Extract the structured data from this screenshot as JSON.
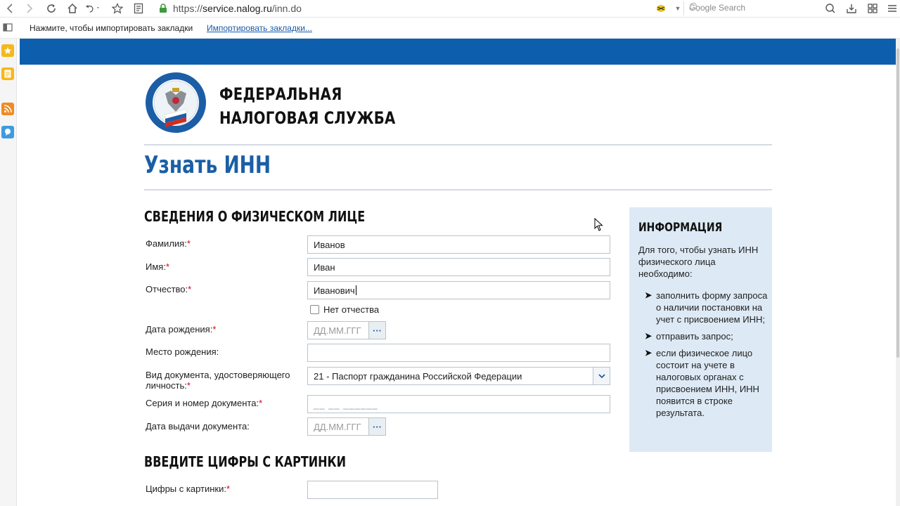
{
  "browser": {
    "url_scheme": "https://",
    "url_host": "service.nalog.ru",
    "url_path": "/inn.do",
    "search_placeholder": "Google Search",
    "bookmarks_prompt": "Нажмите, чтобы импортировать закладки",
    "bookmarks_link": "Импортировать закладки...",
    "icons": [
      "back-icon",
      "forward-icon",
      "reload-icon",
      "home-icon",
      "undo-icon",
      "star-icon",
      "reader-icon",
      "lock-icon",
      "extension-icon",
      "search-icon",
      "account-icon",
      "download-icon",
      "grid-icon",
      "menu-icon"
    ]
  },
  "header": {
    "org_line1": "ФЕДЕРАЛЬНАЯ",
    "org_line2": "НАЛОГОВАЯ СЛУЖБА",
    "page_title": "Узнать ИНН"
  },
  "form": {
    "section_title": "СВЕДЕНИЯ О ФИЗИЧЕСКОМ ЛИЦЕ",
    "required_mark": "*",
    "surname": {
      "label": "Фамилия:",
      "value": "Иванов"
    },
    "name": {
      "label": "Имя:",
      "value": "Иван"
    },
    "patronymic": {
      "label": "Отчество:",
      "value": "Иванович"
    },
    "no_patronymic_label": "Нет отчества",
    "birth_date": {
      "label": "Дата рождения:",
      "placeholder": "ДД.ММ.ГГГ",
      "button": "···"
    },
    "birth_place": {
      "label": "Место рождения:",
      "value": ""
    },
    "doc_type": {
      "label_line1": "Вид документа, удостоверяющего",
      "label_line2": "личность:",
      "value": "21 - Паспорт гражданина Российской Федерации"
    },
    "doc_number": {
      "label": "Серия и номер документа:",
      "mask": "__ __ ______"
    },
    "issue_date": {
      "label": "Дата выдачи документа:",
      "placeholder": "ДД.ММ.ГГГ",
      "button": "···"
    },
    "captcha_section_title": "ВВЕДИТЕ ЦИФРЫ С КАРТИНКИ",
    "captcha": {
      "label": "Цифры с картинки:",
      "value": ""
    }
  },
  "info": {
    "title": "ИНФОРМАЦИЯ",
    "intro": "Для того, чтобы узнать ИНН физического лица необходимо:",
    "items": [
      "заполнить форму запроса о наличии постановки на учет с присвоением ИНН;",
      "отправить запрос;",
      "если физическое лицо состоит на учете в налоговых органах с присвоением ИНН, ИНН появится в строке результата."
    ],
    "bullet": "➤"
  },
  "colors": {
    "brand_blue": "#0d5fae",
    "title_blue": "#1b5ea6",
    "info_bg": "#dde9f5",
    "required": "#d0021b"
  }
}
